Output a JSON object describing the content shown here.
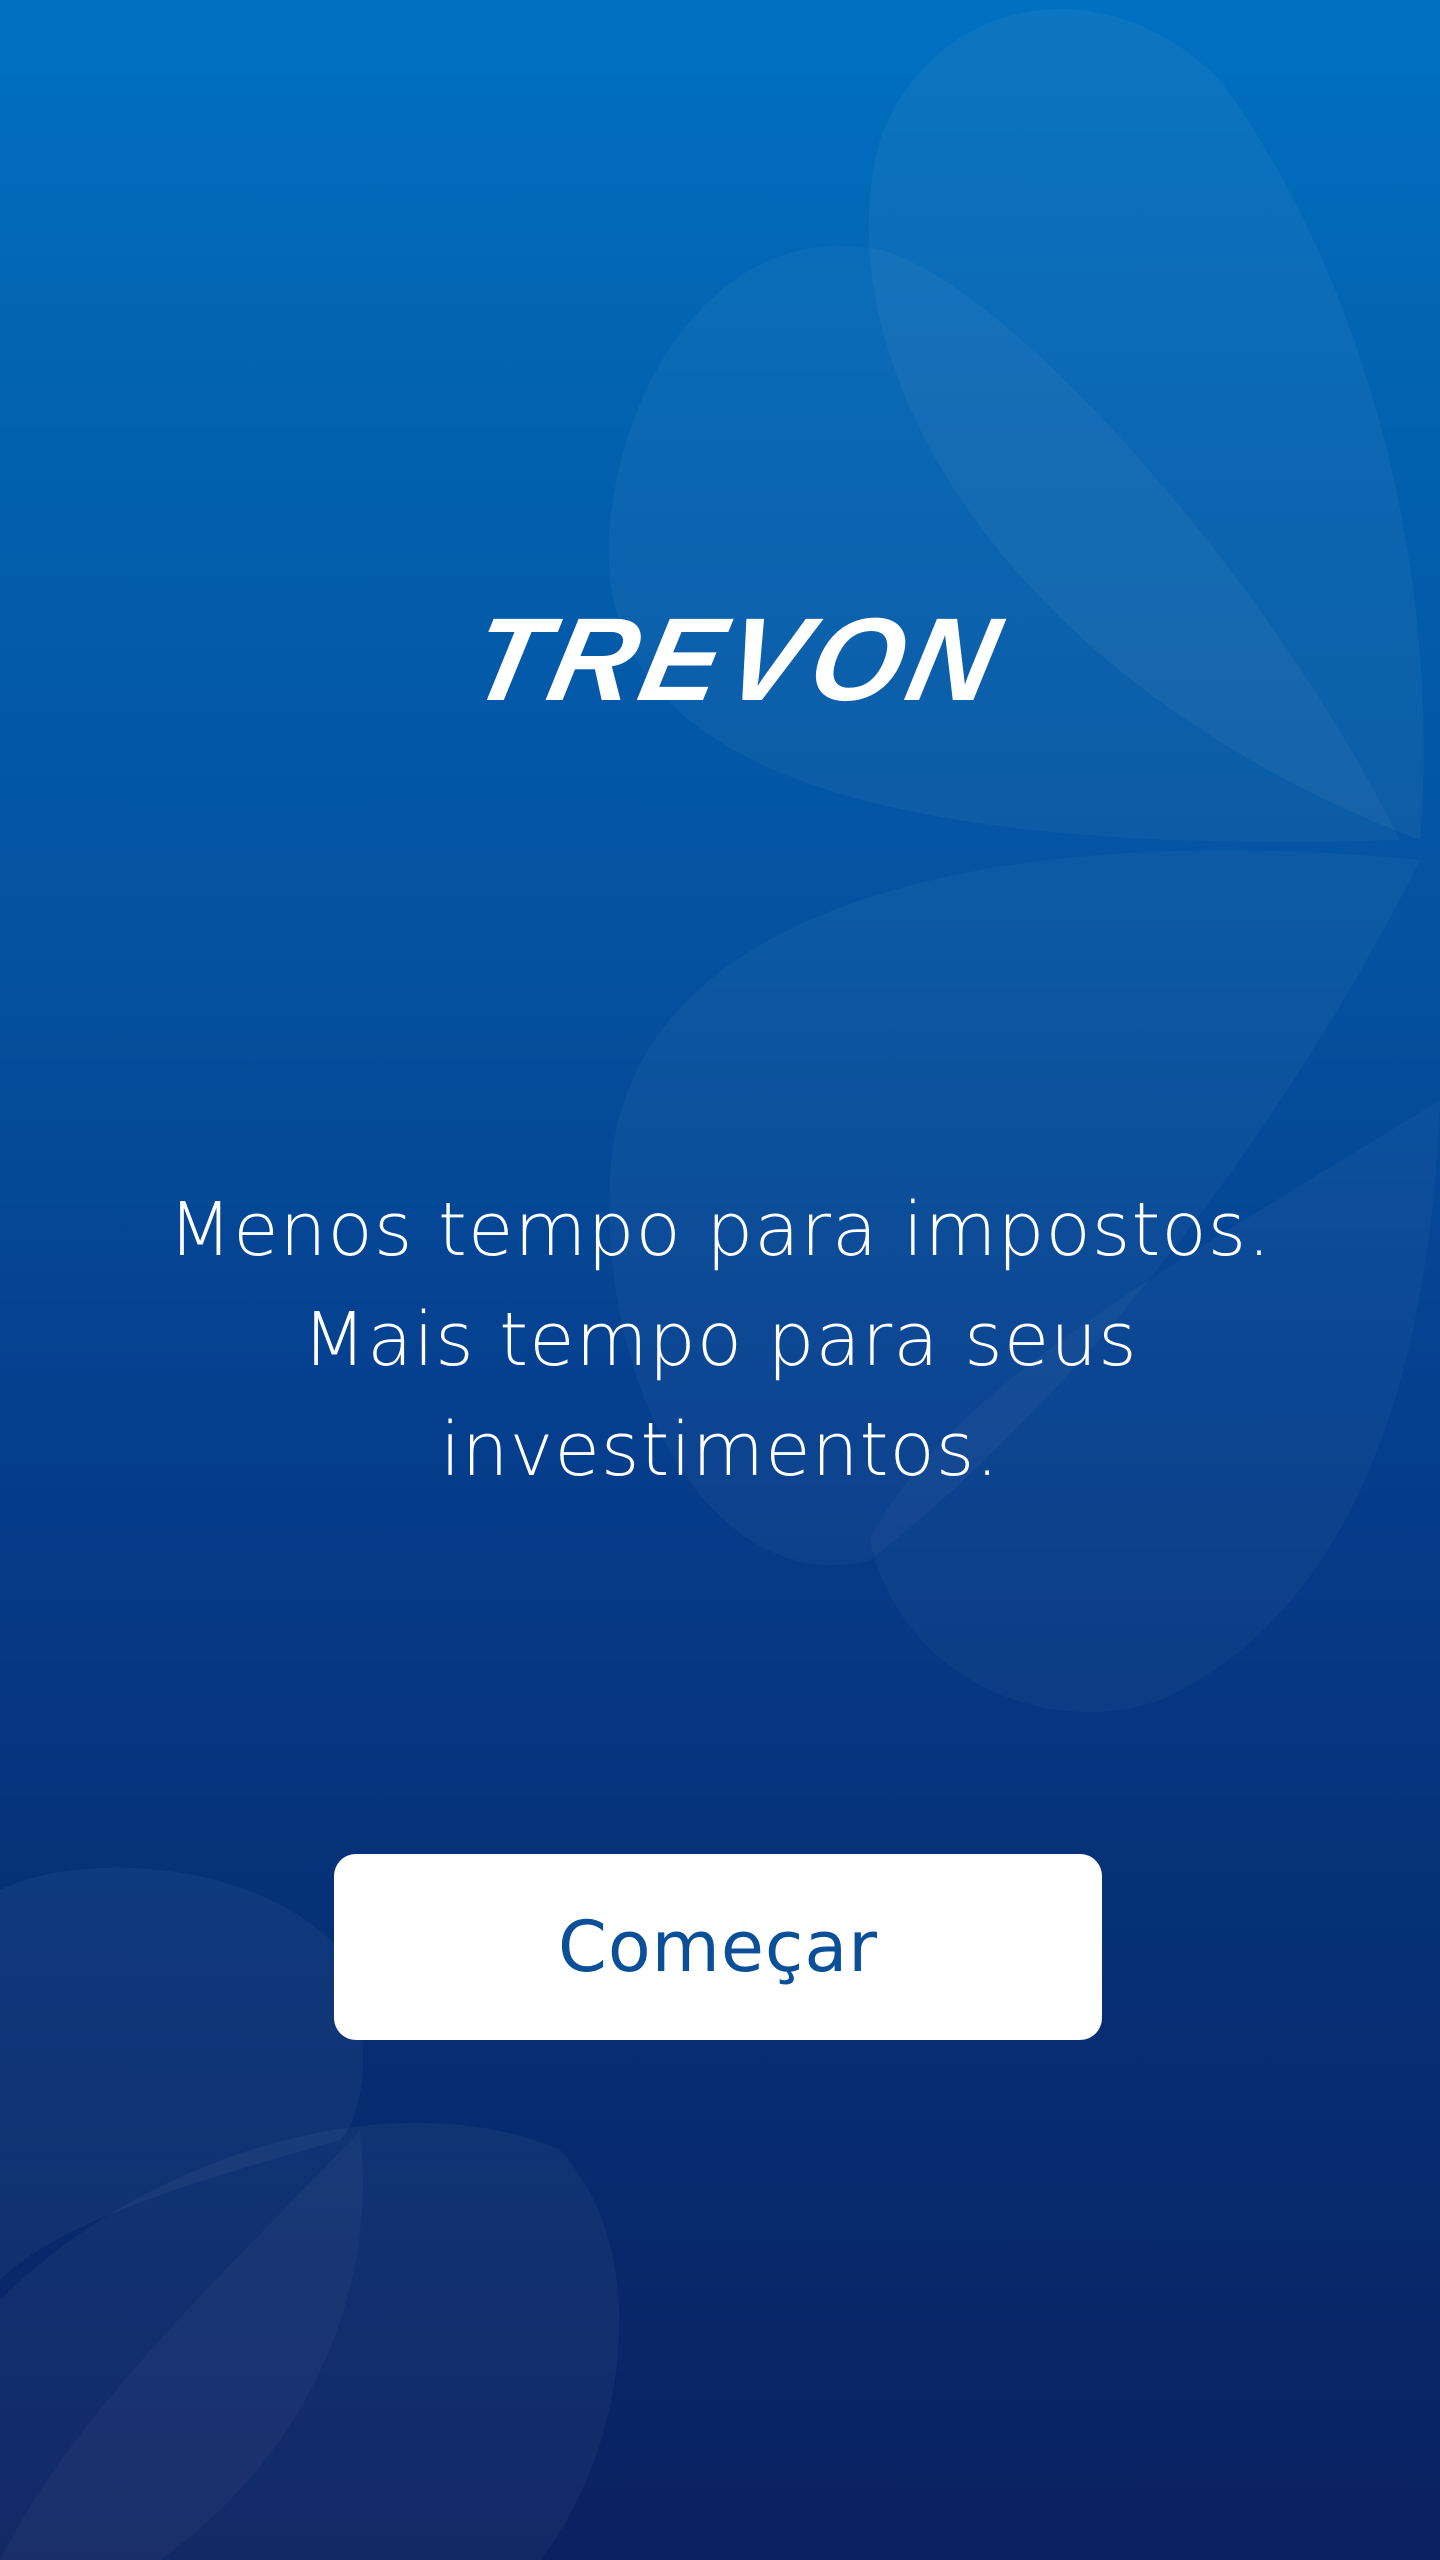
{
  "brand": {
    "logo_text": "TREVON"
  },
  "tagline": {
    "line1": "Menos tempo para impostos.",
    "line2": "Mais tempo para seus",
    "line3": "investimentos."
  },
  "cta": {
    "label": "Começar"
  },
  "colors": {
    "background_top": "#0170c1",
    "background_bottom": "#0a2160",
    "button_background": "#ffffff",
    "button_text": "#0a4f98",
    "text": "#ffffff"
  }
}
